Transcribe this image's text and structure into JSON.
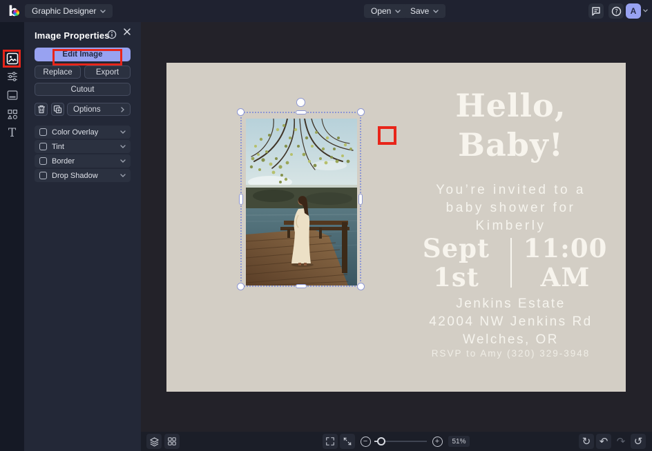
{
  "topbar": {
    "product_label": "Graphic Designer",
    "open_label": "Open",
    "save_label": "Save",
    "avatar_initial": "A"
  },
  "sidebar": {
    "items": [
      {
        "name": "image-manager",
        "active": true
      },
      {
        "name": "adjustments",
        "active": false
      },
      {
        "name": "frames",
        "active": false
      },
      {
        "name": "graphics",
        "active": false
      },
      {
        "name": "text",
        "active": false
      }
    ],
    "text_tool_glyph": "T"
  },
  "panel": {
    "title": "Image Properties",
    "edit_label": "Edit Image",
    "replace_label": "Replace",
    "export_label": "Export",
    "cutout_label": "Cutout",
    "options_label": "Options",
    "toggles": [
      {
        "label": "Color Overlay",
        "checked": false
      },
      {
        "label": "Tint",
        "checked": false
      },
      {
        "label": "Border",
        "checked": false
      },
      {
        "label": "Drop Shadow",
        "checked": false
      }
    ]
  },
  "card": {
    "title_lines": [
      "Hello,",
      "Baby!"
    ],
    "invite_lines": [
      "You’re invited to a",
      "baby shower for",
      "Kimberly"
    ],
    "date_lines": [
      "Sept",
      "1st"
    ],
    "time_lines": [
      "11:00",
      "AM"
    ],
    "address_lines": [
      "Jenkins Estate",
      "42004 NW Jenkins Rd",
      "Welches, OR"
    ],
    "rsvp": "RSVP to Amy (320) 329-3948"
  },
  "bottombar": {
    "zoom_level": "51%"
  },
  "colors": {
    "accent": "#98a2f1",
    "annotation_red": "#e8251a",
    "card_background": "#d3cec5",
    "selection": "#8d97d4"
  }
}
